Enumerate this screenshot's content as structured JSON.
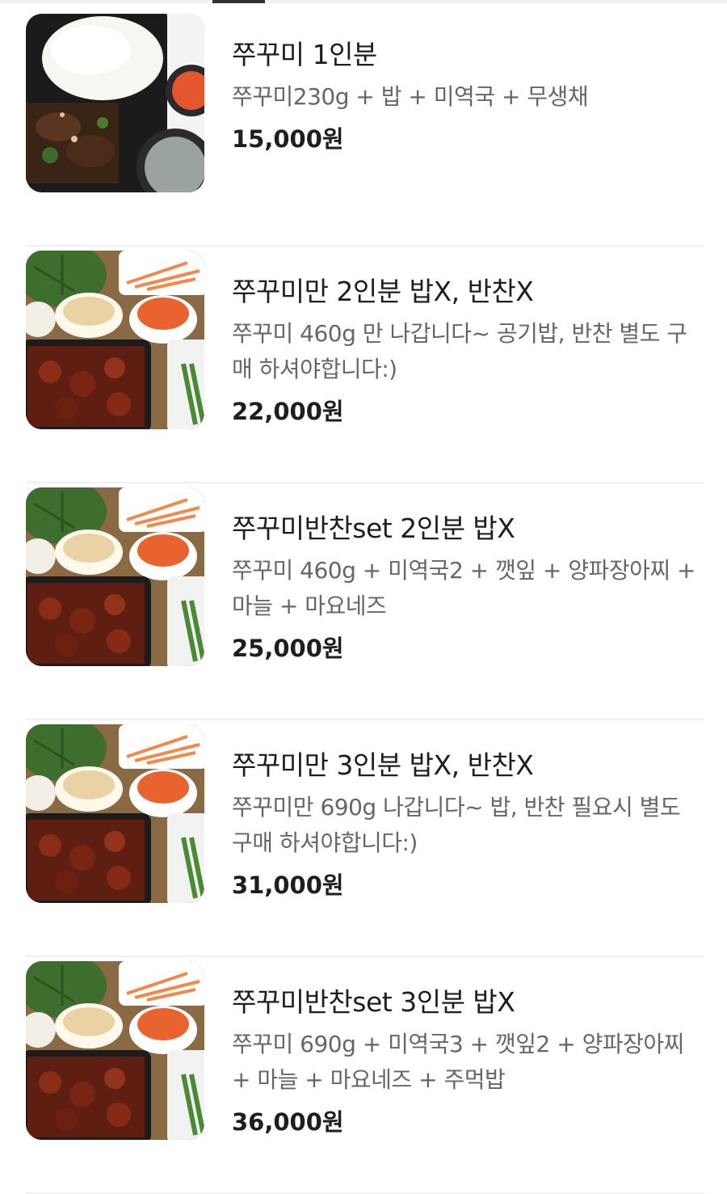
{
  "menu_items": [
    {
      "name": "쭈꾸미 1인분",
      "description": "쭈꾸미230g + 밥 + 미역국 + 무생채",
      "price": "15,000원",
      "image": "single-box"
    },
    {
      "name": "쭈꾸미만 2인분 밥X, 반찬X",
      "description": "쭈꾸미 460g 만 나갑니다~ 공기밥, 반찬 별도 구매 하셔야합니다:)",
      "price": "22,000원",
      "image": "sidedish-set"
    },
    {
      "name": "쭈꾸미반찬set 2인분 밥X",
      "description": "쭈꾸미 460g + 미역국2 + 깻잎 + 양파장아찌 + 마늘 + 마요네즈",
      "price": "25,000원",
      "image": "sidedish-set"
    },
    {
      "name": "쭈꾸미만 3인분 밥X, 반찬X",
      "description": "쭈꾸미만 690g 나갑니다~ 밥, 반찬 필요시 별도 구매 하셔야합니다:)",
      "price": "31,000원",
      "image": "sidedish-set"
    },
    {
      "name": "쭈꾸미반찬set 3인분 밥X",
      "description": "쭈꾸미 690g + 미역국3 + 깻잎2 + 양파장아찌 + 마늘 + 마요네즈 + 주먹밥",
      "price": "36,000원",
      "image": "sidedish-set"
    }
  ]
}
